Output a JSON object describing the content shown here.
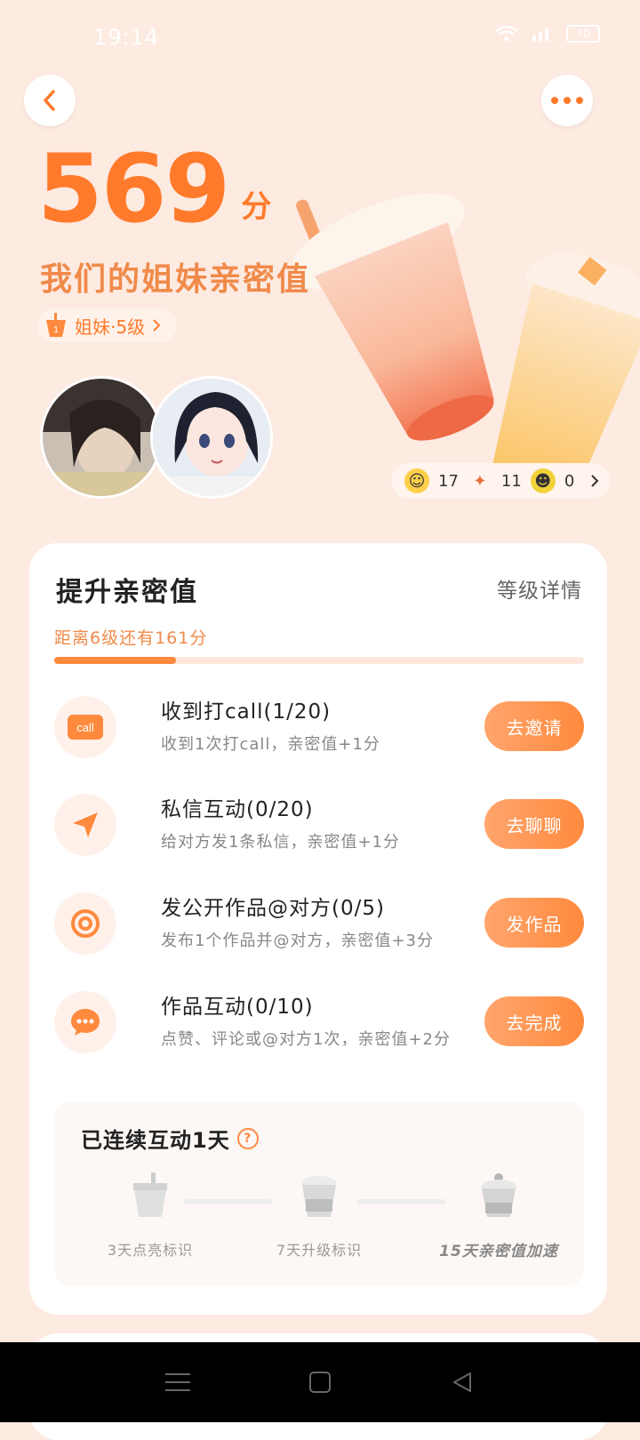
{
  "status_bar": {
    "time": "19:14",
    "battery": "30"
  },
  "header": {
    "back_icon": "chevron-left-icon",
    "more_icon": "more-dots-icon"
  },
  "hero": {
    "score": "569",
    "score_unit": "分",
    "subtitle": "我们的姐妹亲密值",
    "level_badge": "姐妹·5级",
    "emoji_counts": [
      {
        "icon": "hug-emoji-icon",
        "count": "17"
      },
      {
        "icon": "party-popper-icon",
        "count": "11"
      },
      {
        "icon": "lemon-face-icon",
        "count": "0"
      }
    ]
  },
  "card": {
    "title": "提升亲密值",
    "link": "等级详情",
    "progress_text": "距离6级还有161分",
    "progress_fraction": 0.23,
    "tasks": [
      {
        "icon": "call-icon",
        "title": "收到打call(1/20)",
        "desc": "收到1次打call，亲密值+1分",
        "button": "去邀请"
      },
      {
        "icon": "send-icon",
        "title": "私信互动(0/20)",
        "desc": "给对方发1条私信，亲密值+1分",
        "button": "去聊聊"
      },
      {
        "icon": "at-sign-icon",
        "title": "发公开作品@对方(0/5)",
        "desc": "发布1个作品并@对方，亲密值+3分",
        "button": "发作品"
      },
      {
        "icon": "comment-icon",
        "title": "作品互动(0/10)",
        "desc": "点赞、评论或@对方1次，亲密值+2分",
        "button": "去完成"
      }
    ],
    "streak": {
      "title": "已连续互动1天",
      "milestones": [
        {
          "label": "3天点亮标识"
        },
        {
          "label": "7天升级标识"
        },
        {
          "label": "15天亲密值加速"
        }
      ]
    }
  },
  "colors": {
    "accent": "#ff8a3d",
    "background": "#fdeae1"
  }
}
